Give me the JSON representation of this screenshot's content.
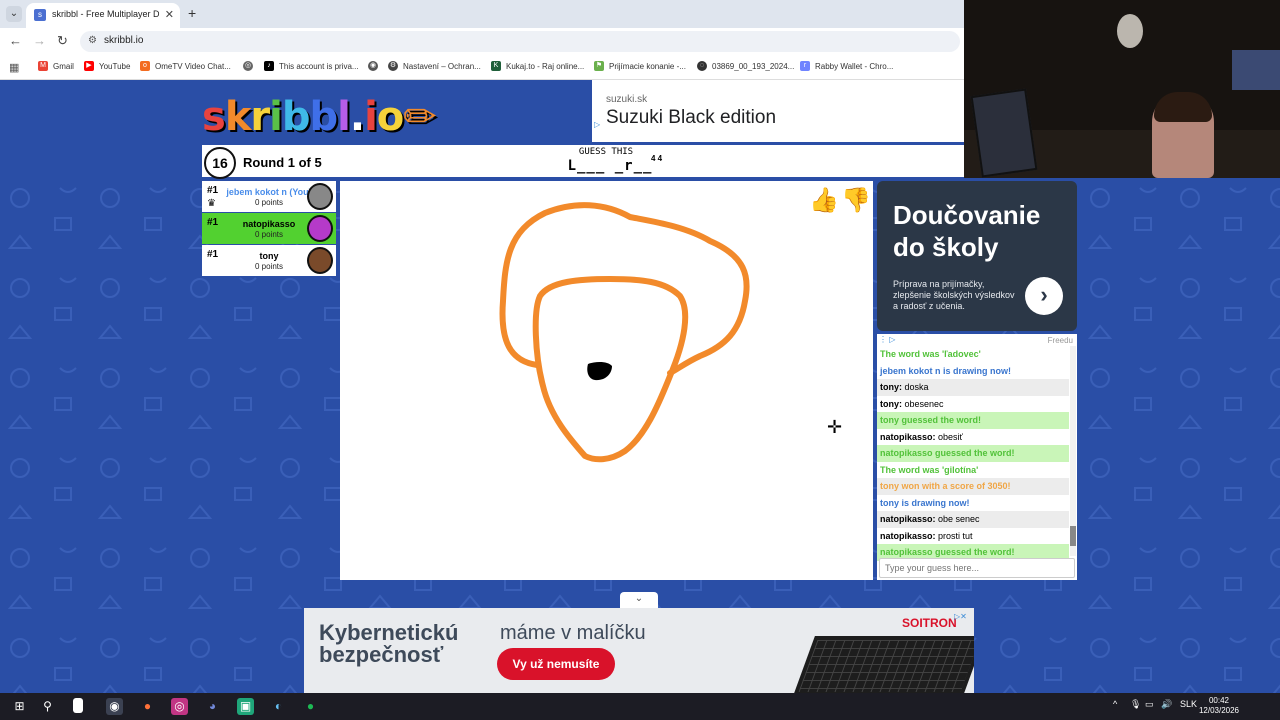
{
  "browser": {
    "tab_title": "skribbl - Free Multiplayer Draw...",
    "url": "skribbl.io",
    "bookmarks": [
      "Gmail",
      "YouTube",
      "OmeTV Video Chat...",
      "",
      "This account is priva...",
      "",
      "Nastavení – Ochran...",
      "Kukaj.to - Raj online...",
      "Prijímacie konanie -...",
      "03869_00_193_2024...",
      "Rabby Wallet - Chro..."
    ]
  },
  "logo": {
    "parts": [
      "s",
      "k",
      "r",
      "i",
      "b",
      "b",
      "l",
      ".",
      "i",
      "o",
      "✏"
    ],
    "colors": [
      "#e8433f",
      "#f28a2b",
      "#f5d23a",
      "#5ac048",
      "#3fb9e8",
      "#3f6fe8",
      "#b65de8",
      "#fff",
      "#e8433f",
      "#f5d23a",
      "#f28a2b"
    ]
  },
  "ad_top": {
    "domain": "suzuki.sk",
    "title": "Suzuki Black edition"
  },
  "game": {
    "timer": "16",
    "round": "Round 1 of 5",
    "guess_label": "GUESS THIS",
    "word_hint": "L___ _r__",
    "word_lengths": "4 4"
  },
  "players": [
    {
      "rank": "#1",
      "name": "jebem kokot n (You)",
      "points": "0 points",
      "you": true,
      "avatar_color": "#888888"
    },
    {
      "rank": "#1",
      "name": "natopikasso",
      "points": "0 points",
      "active": true,
      "avatar_color": "#b53ac9"
    },
    {
      "rank": "#1",
      "name": "tony",
      "points": "0 points",
      "avatar_color": "#7a4a2a"
    }
  ],
  "ad_right": {
    "title": "Doučovanie\ndo školy",
    "subtitle": "Príprava na prijímačky, zlepšenie školských výsledkov a radosť z učenia."
  },
  "chat": {
    "ad_strip": "Freedu",
    "messages": [
      {
        "type": "green",
        "text": "The word was 'ľadovec'"
      },
      {
        "type": "blue",
        "text": "jebem kokot n is drawing now!"
      },
      {
        "type": "user",
        "user": "tony",
        "text": "doska"
      },
      {
        "type": "user",
        "user": "tony",
        "text": "obesenec"
      },
      {
        "type": "greenbg",
        "text": "tony guessed the word!"
      },
      {
        "type": "user",
        "user": "natopikasso",
        "text": "obesiť"
      },
      {
        "type": "greenbg",
        "text": "natopikasso guessed the word!"
      },
      {
        "type": "green",
        "text": "The word was 'gilotína'"
      },
      {
        "type": "orange",
        "text": "tony won with a score of 3050!"
      },
      {
        "type": "blue",
        "text": "tony is drawing now!"
      },
      {
        "type": "user",
        "user": "natopikasso",
        "text": "obe senec"
      },
      {
        "type": "user",
        "user": "natopikasso",
        "text": "prosti tut"
      },
      {
        "type": "greenbg",
        "text": "natopikasso guessed the word!"
      }
    ],
    "input_placeholder": "Type your guess here..."
  },
  "ad_bottom": {
    "title": "Kybernetickú\nbezpečnosť",
    "slogan": "máme v malíčku",
    "button": "Vy už nemusíte",
    "brand": "SOITRON"
  },
  "taskbar": {
    "lang": "SLK",
    "time": "00:42",
    "date": "12/03/2026"
  },
  "colors": {
    "brush": "#f28a2b",
    "page_bg": "#2a4ea6",
    "active_player": "#52d130"
  }
}
